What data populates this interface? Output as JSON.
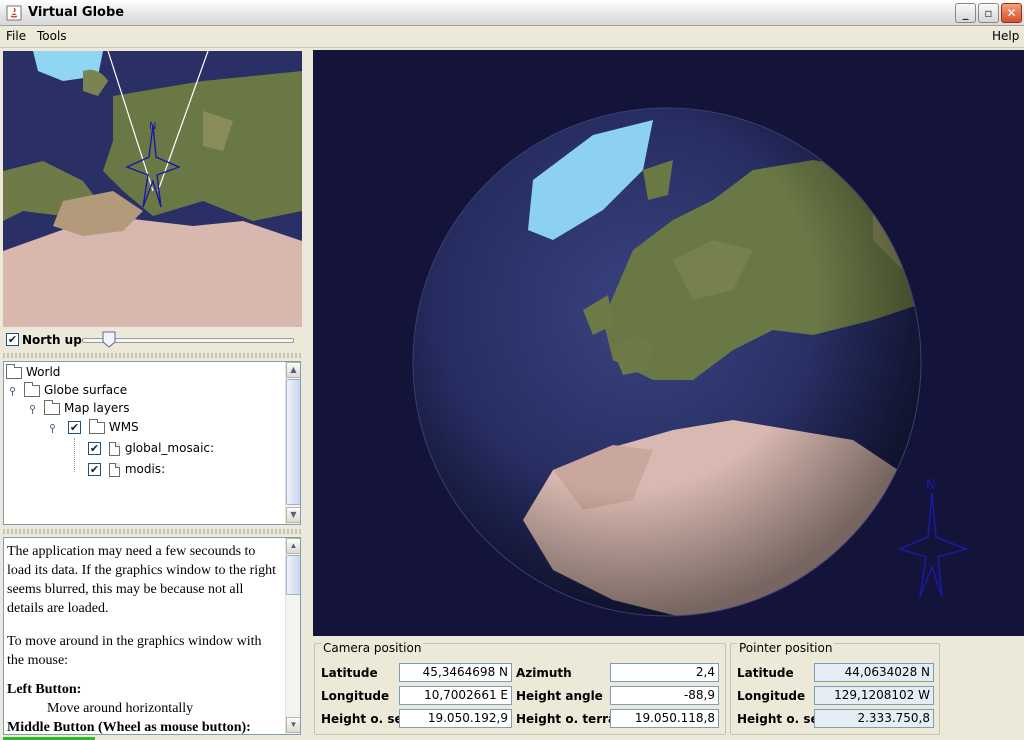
{
  "window": {
    "title": "Virtual Globe",
    "buttons": {
      "minimize": "_",
      "maximize": "▫",
      "close": "✕"
    }
  },
  "menu": {
    "file": "File",
    "tools": "Tools",
    "help": "Help"
  },
  "overview": {
    "north_up_label": "North up",
    "north_up_checked": "✔",
    "zoom_slider_value": 0.1
  },
  "tree": {
    "nodes": [
      {
        "label": "World"
      },
      {
        "label": "Globe surface"
      },
      {
        "label": "Map layers"
      },
      {
        "label": "WMS",
        "checked": "✔"
      },
      {
        "label": "global_mosaic:",
        "checked": "✔"
      },
      {
        "label": "modis:",
        "checked": "✔"
      }
    ]
  },
  "help_text": {
    "p1": "The application may need a few secounds to load its data. If the graphics window to the right seems blurred, this may be because not all details are loaded.",
    "p2": "To move around in the graphics window with the mouse:",
    "left_button": "Left Button:",
    "left_desc": "Move around horizontally",
    "middle_button": "Middle Button (Wheel as mouse button):"
  },
  "camera": {
    "title": "Camera position",
    "latitude_label": "Latitude",
    "latitude": "45,3464698 N",
    "longitude_label": "Longitude",
    "longitude": "10,7002661 E",
    "height_sea_label": "Height o. sea",
    "height_sea": "19.050.192,9",
    "azimuth_label": "Azimuth",
    "azimuth": "2,4",
    "height_angle_label": "Height angle",
    "height_angle": "-88,9",
    "height_terrain_label": "Height o. terrain",
    "height_terrain": "19.050.118,8"
  },
  "pointer": {
    "title": "Pointer position",
    "latitude_label": "Latitude",
    "latitude": "44,0634028 N",
    "longitude_label": "Longitude",
    "longitude": "129,1208102 W",
    "height_sea_label": "Height o. sea",
    "height_sea": "2.333.750,8"
  },
  "compass_letter": "N",
  "colors": {
    "space": "#14133a",
    "ocean": "#28306a",
    "land": "#6e7a4a",
    "desert": "#d8b8b0",
    "ice": "#8ad0f0",
    "compass": "#1a1aa0"
  }
}
